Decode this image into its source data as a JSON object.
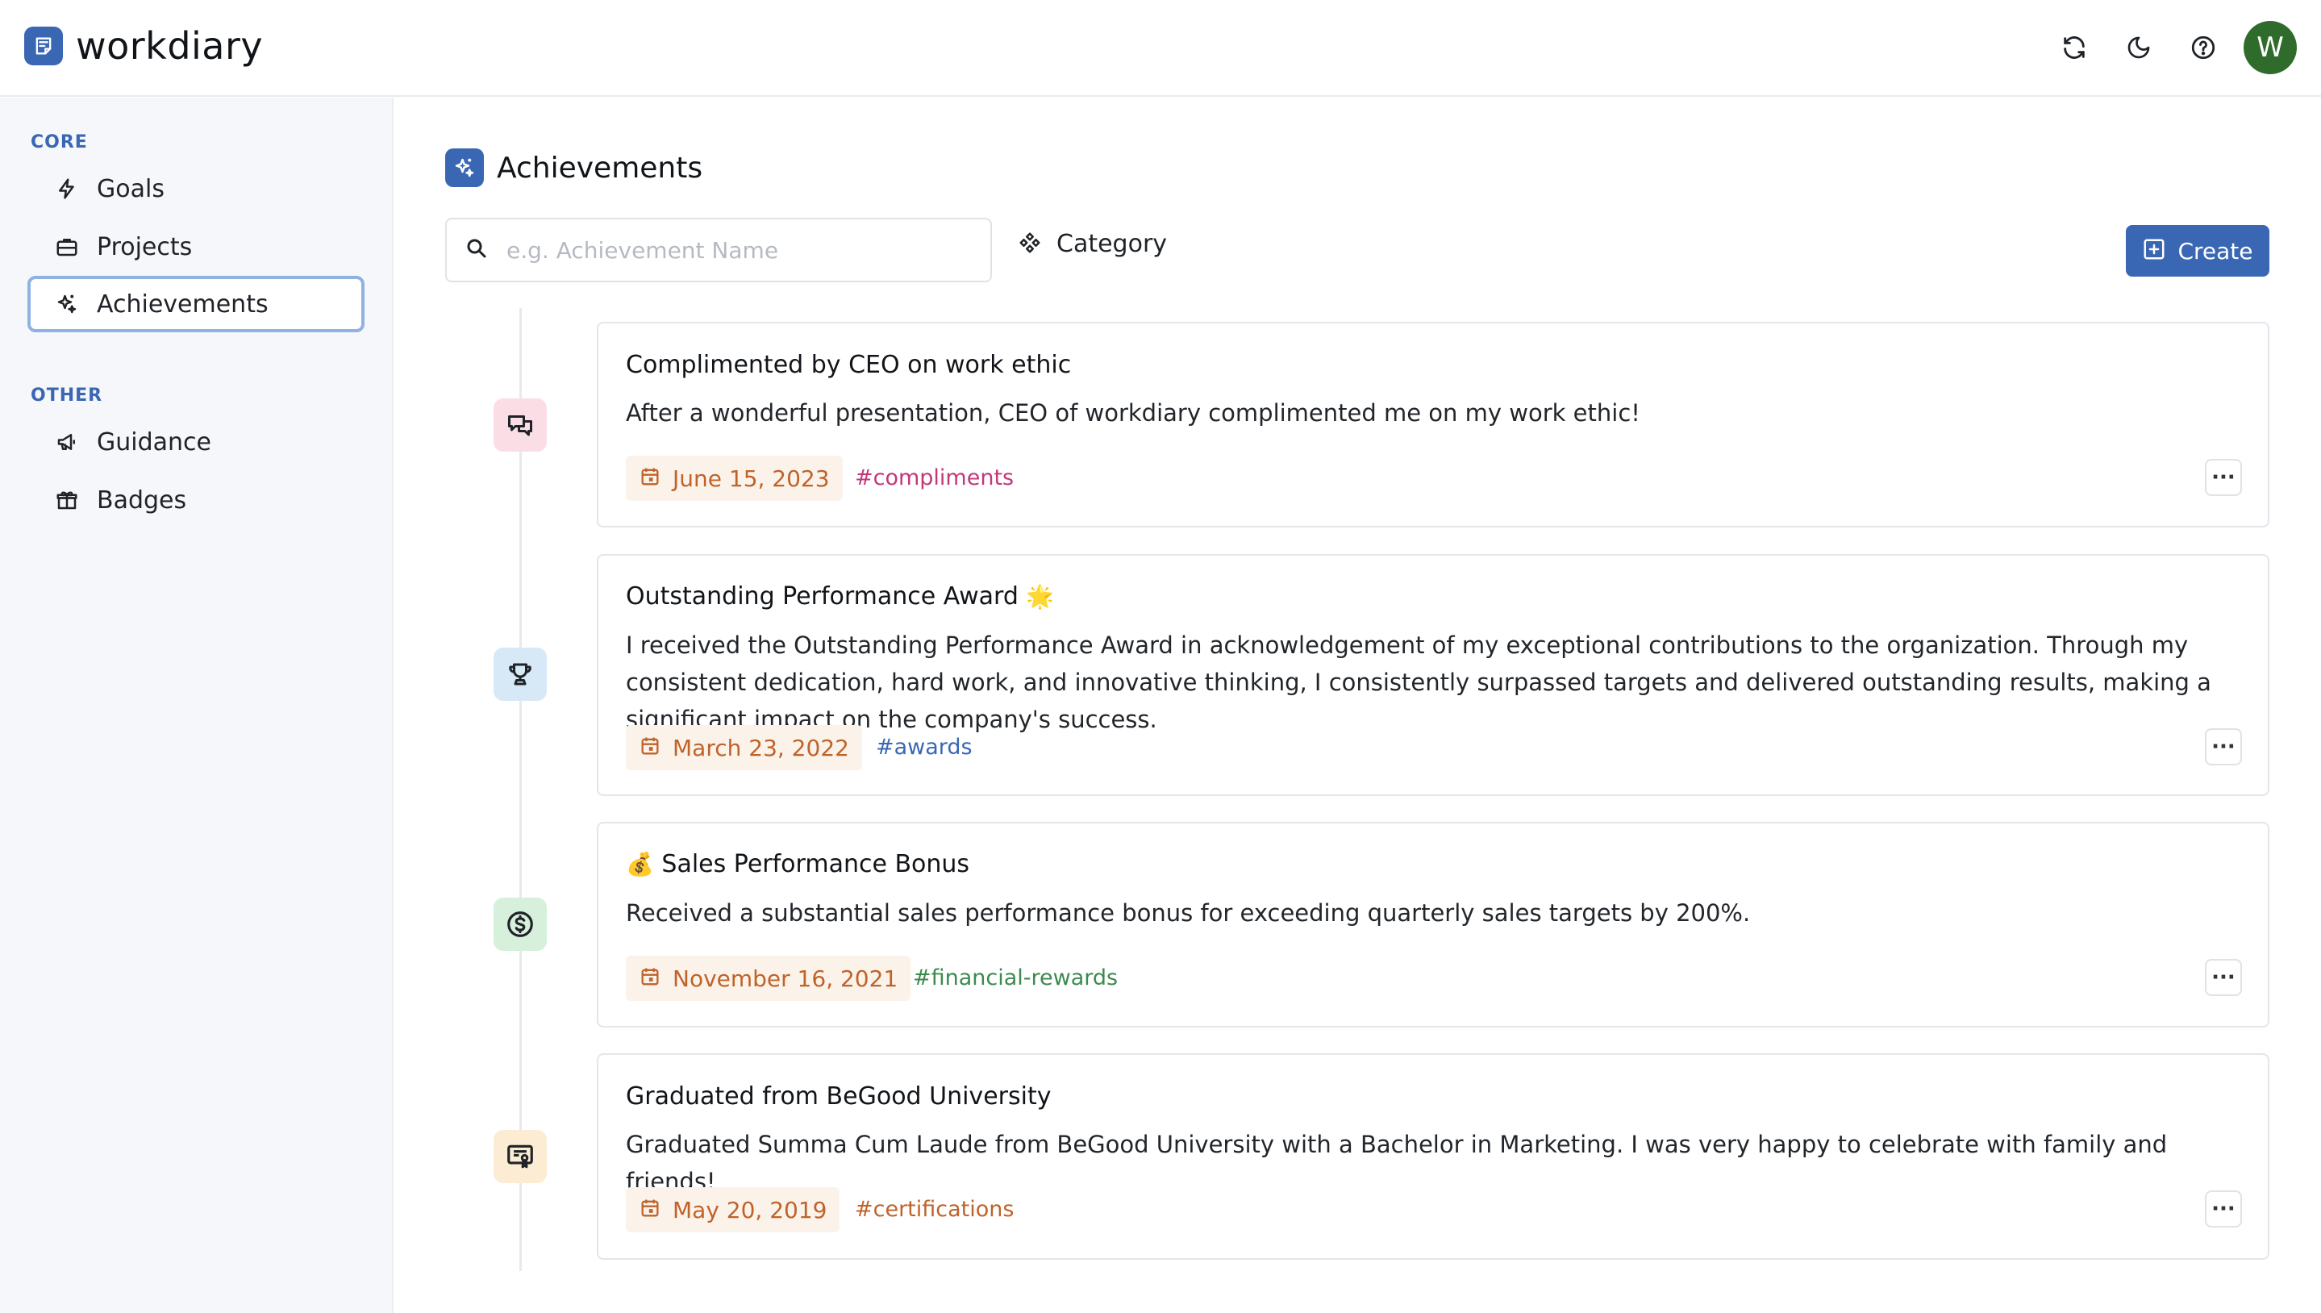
{
  "app": {
    "name": "workdiary"
  },
  "header": {
    "avatar_letter": "W"
  },
  "sidebar": {
    "core_title": "CORE",
    "other_title": "OTHER",
    "items": [
      {
        "label": "Goals",
        "icon": "bolt-icon"
      },
      {
        "label": "Projects",
        "icon": "briefcase-icon"
      },
      {
        "label": "Achievements",
        "icon": "sparkles-icon",
        "active": true
      },
      {
        "label": "Guidance",
        "icon": "megaphone-icon"
      },
      {
        "label": "Badges",
        "icon": "gift-icon"
      }
    ]
  },
  "main": {
    "title": "Achievements",
    "search_placeholder": "e.g. Achievement Name",
    "category_label": "Category",
    "create_label": "Create"
  },
  "achievements": [
    {
      "title": "Complimented by CEO on work ethic",
      "description": "After a wonderful presentation, CEO of workdiary complimented me on my work ethic!",
      "date": "June 15, 2023",
      "tag": "#compliments",
      "tag_color": "#c2387a",
      "icon": "chat-bubbles-icon",
      "icon_bg": "#fbdde6"
    },
    {
      "title": "Outstanding Performance Award",
      "title_emoji": "🌟",
      "description": "I received the Outstanding Performance Award in acknowledgement of my exceptional contributions to the organization. Through my consistent dedication, hard work, and innovative thinking, I consistently surpassed targets and delivered outstanding results, making a significant impact on the company's success.",
      "date": "March 23, 2022",
      "tag": "#awards",
      "tag_color": "#3a67b4",
      "icon": "trophy-icon",
      "icon_bg": "#d7e8f7"
    },
    {
      "title_emoji": "💰",
      "title": "Sales Performance Bonus",
      "description": "Received a substantial sales performance bonus for exceeding quarterly sales targets by 200%.",
      "date": "November 16, 2021",
      "tag": "#financial-rewards",
      "tag_color": "#3c8a4e",
      "icon": "dollar-coin-icon",
      "icon_bg": "#d6f0dc"
    },
    {
      "title": "Graduated from BeGood University",
      "description": "Graduated Summa Cum Laude from BeGood University with a Bachelor in Marketing. I was very happy to celebrate with family and friends!",
      "date": "May 20, 2019",
      "tag": "#certifications",
      "tag_color": "#c0632a",
      "icon": "certificate-icon",
      "icon_bg": "#fbecd3"
    }
  ],
  "colors": {
    "brand": "#3a67b4",
    "date_text": "#c0632a",
    "date_bg": "#fbf3ea"
  }
}
